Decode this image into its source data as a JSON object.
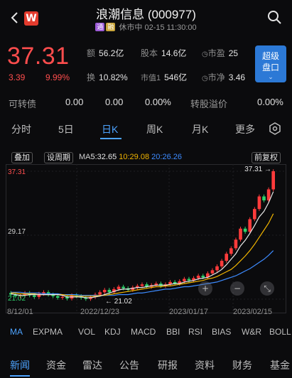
{
  "header": {
    "title": "浪潮信息 (000977)",
    "tag1": "通",
    "tag2": "融",
    "status": "休市中 02-15 11:30:00",
    "logo_letter": "W"
  },
  "quote": {
    "price": "37.31",
    "change": "3.39",
    "change_pct": "9.99%",
    "amount_label": "额",
    "amount": "56.2亿",
    "capital_label": "股本",
    "capital": "14.6亿",
    "pe_label": "市盈",
    "pe": "25",
    "turnover_label": "换",
    "turnover": "10.82%",
    "mcap_label": "市值1",
    "mcap": "546亿",
    "pb_label": "市净",
    "pb": "3.46",
    "super_line1": "超级",
    "super_line2": "盘口",
    "up_color": "#ff4d4d"
  },
  "convertible": {
    "label": "可转债",
    "v1": "0.00",
    "v2": "0.00",
    "v3": "0.00%",
    "premium_label": "转股溢价",
    "premium": "0.00%"
  },
  "periods": {
    "items": [
      "分时",
      "5日",
      "日K",
      "周K",
      "月K",
      "更多"
    ],
    "active": "日K"
  },
  "toolbar": {
    "overlay": "叠加",
    "set_period": "设周期",
    "ma_label": "MA",
    "ma5": "5:32.65",
    "ma10": "10:29.08",
    "ma20": "20:26.26",
    "adjust": "前复权"
  },
  "axis": {
    "y_top": "37.31",
    "y_mid": "29.17",
    "y_low": "21.02",
    "max_label": "37.31",
    "min_label": "21.02"
  },
  "dates": [
    "8/12/01",
    "2022/12/23",
    "2023/01/17",
    "2023/02/15"
  ],
  "indicators": {
    "items": [
      "MA",
      "EXPMA",
      "VOL",
      "KDJ",
      "MACD",
      "BBI",
      "RSI",
      "BIAS",
      "W&R",
      "BOLL"
    ],
    "active": "MA"
  },
  "bottom_nav": {
    "items": [
      "新闻",
      "资金",
      "雷达",
      "公告",
      "研报",
      "资料",
      "财务",
      "基金"
    ],
    "active": "新闻"
  },
  "chart_data": {
    "type": "candlestick",
    "ylim": [
      21.02,
      37.31
    ],
    "closes": [
      21.6,
      21.4,
      21.5,
      21.8,
      21.5,
      21.3,
      21.7,
      21.9,
      21.6,
      21.4,
      21.2,
      21.3,
      21.1,
      21.5,
      21.4,
      21.2,
      21.05,
      21.3,
      21.6,
      21.9,
      22.2,
      21.9,
      22.3,
      22.6,
      22.4,
      22.2,
      22.5,
      22.7,
      22.9,
      22.6,
      22.8,
      23.0,
      22.7,
      22.9,
      23.2,
      23.0,
      23.3,
      23.6,
      23.4,
      23.7,
      24.0,
      23.8,
      24.3,
      24.7,
      25.2,
      25.9,
      26.8,
      27.5,
      28.6,
      30.0,
      29.6,
      31.2,
      32.5,
      34.1,
      33.6,
      35.0,
      37.31
    ],
    "ma5": [
      21.7,
      21.6,
      21.5,
      21.5,
      21.6,
      21.6,
      21.6,
      21.6,
      21.6,
      21.6,
      21.6,
      21.5,
      21.3,
      21.3,
      21.3,
      21.3,
      21.2,
      21.2,
      21.3,
      21.4,
      21.6,
      21.8,
      22.0,
      22.2,
      22.3,
      22.3,
      22.4,
      22.5,
      22.5,
      22.6,
      22.7,
      22.8,
      22.8,
      22.8,
      22.9,
      23.0,
      23.0,
      23.2,
      23.3,
      23.4,
      23.6,
      23.7,
      23.8,
      24.1,
      24.4,
      24.8,
      25.4,
      26.1,
      26.8,
      27.8,
      28.5,
      29.4,
      30.4,
      31.5,
      32.2,
      33.3,
      34.7
    ],
    "ma10": [
      21.8,
      21.8,
      21.7,
      21.7,
      21.7,
      21.7,
      21.6,
      21.6,
      21.6,
      21.6,
      21.6,
      21.6,
      21.5,
      21.5,
      21.4,
      21.4,
      21.4,
      21.4,
      21.4,
      21.5,
      21.5,
      21.6,
      21.7,
      21.8,
      21.9,
      22.0,
      22.1,
      22.2,
      22.3,
      22.4,
      22.5,
      22.6,
      22.6,
      22.7,
      22.7,
      22.8,
      22.9,
      23.0,
      23.1,
      23.2,
      23.3,
      23.4,
      23.6,
      23.7,
      23.9,
      24.2,
      24.5,
      24.8,
      25.3,
      25.9,
      26.5,
      27.2,
      28.0,
      28.9,
      29.8,
      30.7,
      31.9
    ],
    "ma20": [
      21.9,
      21.9,
      21.9,
      21.8,
      21.8,
      21.8,
      21.8,
      21.7,
      21.7,
      21.7,
      21.7,
      21.6,
      21.6,
      21.6,
      21.6,
      21.5,
      21.5,
      21.5,
      21.5,
      21.5,
      21.5,
      21.5,
      21.5,
      21.6,
      21.6,
      21.6,
      21.7,
      21.8,
      21.8,
      21.9,
      22.0,
      22.1,
      22.2,
      22.3,
      22.3,
      22.4,
      22.5,
      22.6,
      22.6,
      22.7,
      22.8,
      22.9,
      23.0,
      23.1,
      23.2,
      23.4,
      23.6,
      23.8,
      24.0,
      24.3,
      24.6,
      24.9,
      25.3,
      25.7,
      26.1,
      26.6,
      27.2
    ],
    "colors": {
      "up": "#ff3b3b",
      "down": "#2fd36b",
      "ma5": "#e8e8e8",
      "ma10": "#f0b400",
      "ma20": "#3d8bff"
    }
  }
}
